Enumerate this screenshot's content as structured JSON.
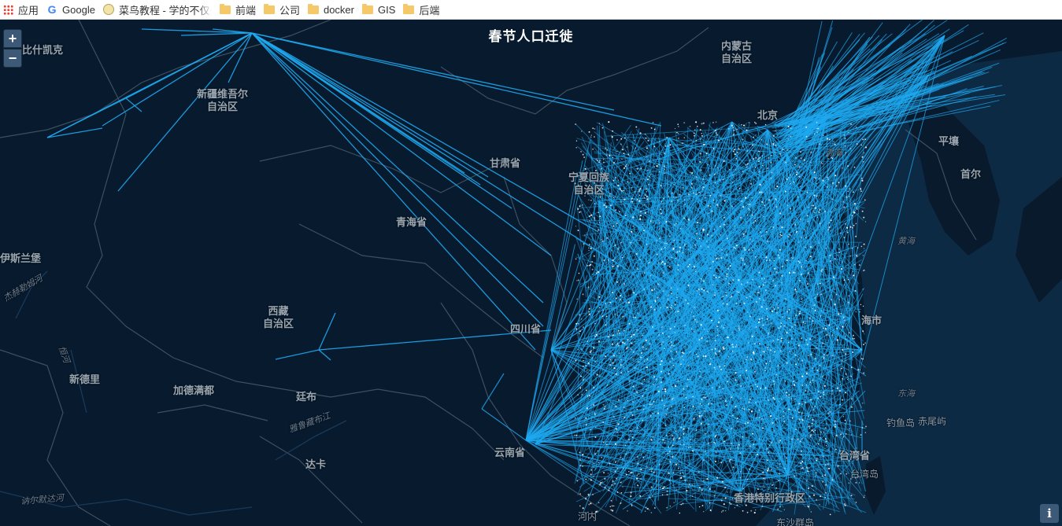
{
  "bookmarks": [
    {
      "icon": "apps-icon",
      "label": "应用"
    },
    {
      "icon": "google-icon",
      "label": "Google"
    },
    {
      "icon": "runoob-icon",
      "label": "菜鸟教程 - 学的不仅是"
    },
    {
      "icon": "folder-icon",
      "label": "前端"
    },
    {
      "icon": "folder-icon",
      "label": "公司"
    },
    {
      "icon": "folder-icon",
      "label": "docker"
    },
    {
      "icon": "folder-icon",
      "label": "GIS"
    },
    {
      "icon": "folder-icon",
      "label": "后端"
    }
  ],
  "map": {
    "title": "春节人口迁徙",
    "zoom_in": "+",
    "zoom_out": "−",
    "info": "i",
    "line_color": "#1eaaf1",
    "background_color": "#071a2e",
    "labels": {
      "bishkek": "比什凯克",
      "xinjiang": "新疆维吾尔\n自治区",
      "neimenggu": "内蒙古\n自治区",
      "beijing": "北京",
      "gansu": "甘肃省",
      "ningxia": "宁夏回族\n自治区",
      "qinghai": "青海省",
      "xizang": "西藏\n自治区",
      "sichuan": "四川省",
      "yunnan": "云南省",
      "pingrang": "平壤",
      "shouer": "首尔",
      "islamabad": "伊斯兰堡",
      "xindeli": "新德里",
      "kathmandu": "加德满都",
      "tingbu": "廷布",
      "daka": "达卡",
      "taiwan": "台湾省",
      "taiwan_island": "台湾岛",
      "hongkong": "香港特别行政区",
      "hanoi": "河内",
      "diaoyu": "钓鱼岛",
      "chiwei": "赤尾屿",
      "shanghai": "海市",
      "bohai": "渤海",
      "huanghai": "黄海",
      "donghai": "东海",
      "indus": "杰赫勒姆河",
      "ganges": "恒河",
      "brahmaputra": "雅鲁藏布江",
      "narmada": "讷尔默达河",
      "nansha": "东沙群岛"
    }
  }
}
